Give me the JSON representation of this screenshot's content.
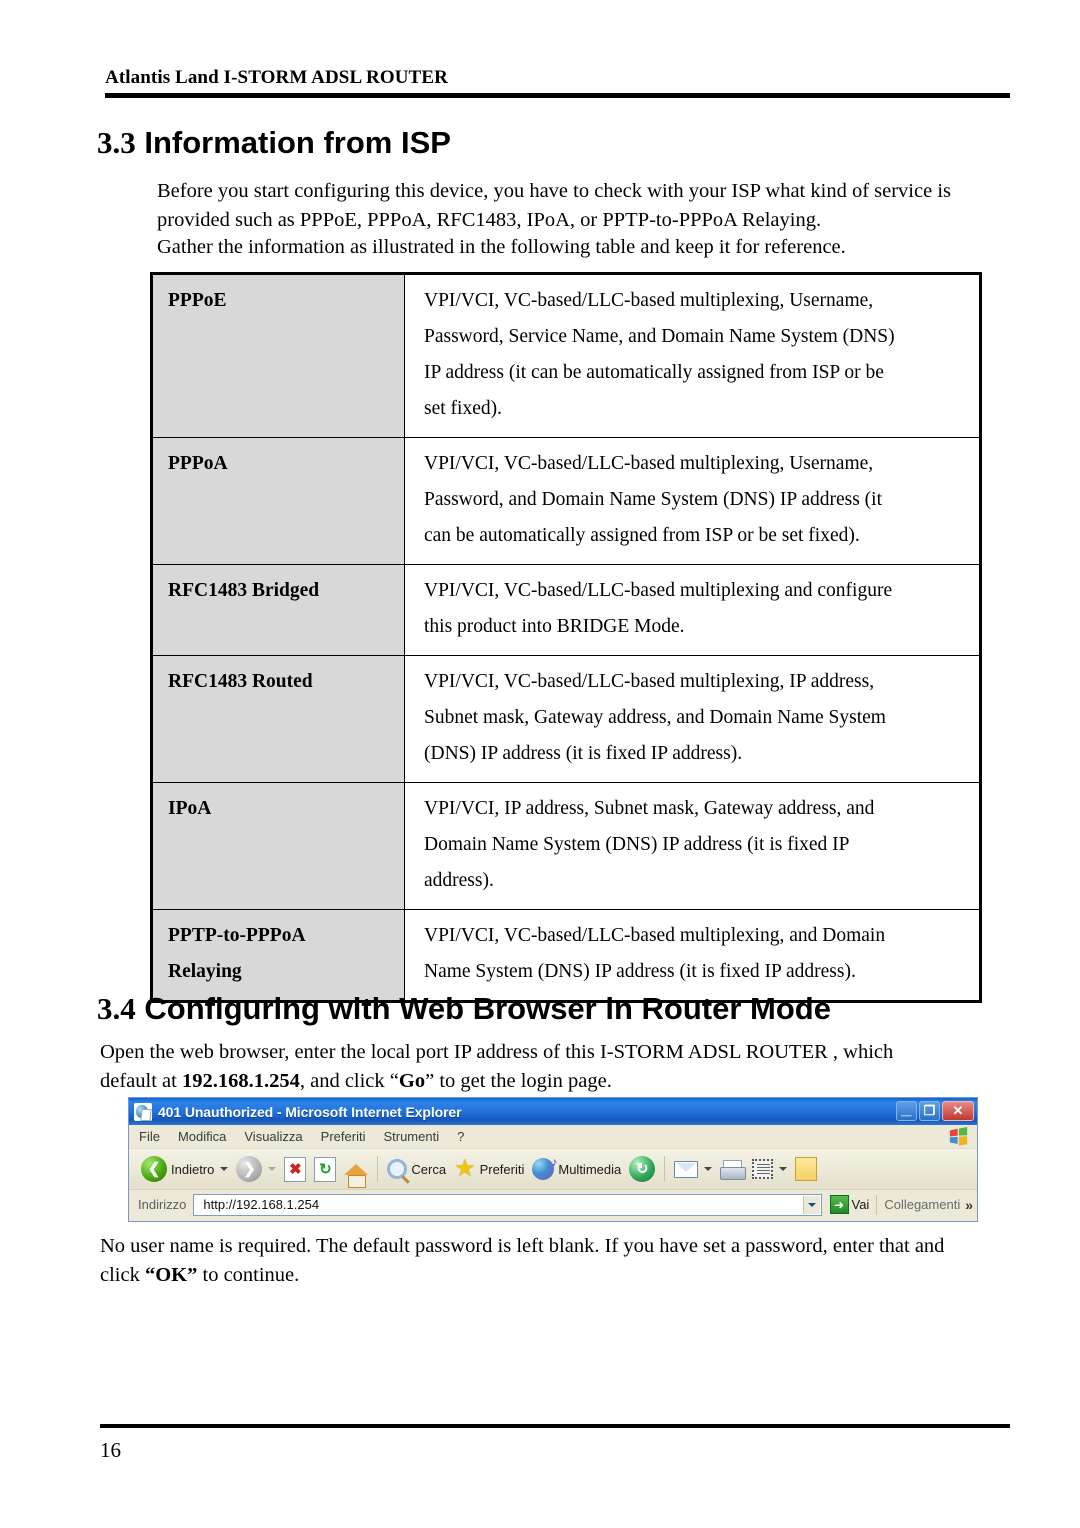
{
  "header": {
    "running_title": "Atlantis Land I-STORM ADSL ROUTER"
  },
  "sections": {
    "s33": {
      "number": "3.3",
      "title": "Information from ISP"
    },
    "s34": {
      "number": "3.4",
      "title": "Configuring with Web Browser in Router Mode"
    }
  },
  "paragraphs": {
    "intro1_line1": "Before you start configuring this device, you have to check with your ISP what kind of service is",
    "intro1_line2": "provided such as PPPoE, PPPoA, RFC1483, IPoA, or PPTP-to-PPPoA Relaying.",
    "intro2": "Gather the information as illustrated in the following table and keep it for reference.",
    "browser_line1_a": "Open the web browser, enter the local port IP address of this I-STORM ADSL ROUTER , which",
    "browser_line2_a": "default at ",
    "browser_line2_b": "192.168.1.254",
    "browser_line2_c": ", and click “",
    "browser_line2_d": "Go",
    "browser_line2_e": "” to get the login page.",
    "login_line1": "No user name is required. The default password is left blank. If you have set a password, enter that and",
    "login_line2_a": "click ",
    "login_line2_b": "“OK”",
    "login_line2_c": " to continue."
  },
  "isp_table": {
    "rows": [
      {
        "key": "PPPoE",
        "lines": [
          "VPI/VCI, VC-based/LLC-based multiplexing, Username,",
          "Password, Service Name, and Domain Name System (DNS)",
          "IP address (it can be automatically assigned from ISP or be",
          "set fixed)."
        ]
      },
      {
        "key": "PPPoA",
        "lines": [
          "VPI/VCI, VC-based/LLC-based multiplexing, Username,",
          "Password, and Domain Name System (DNS) IP address (it",
          "can be automatically assigned from ISP or be set fixed)."
        ]
      },
      {
        "key": "RFC1483 Bridged",
        "lines": [
          "VPI/VCI, VC-based/LLC-based multiplexing and configure",
          "this product into BRIDGE Mode."
        ]
      },
      {
        "key": "RFC1483 Routed",
        "lines": [
          "VPI/VCI, VC-based/LLC-based multiplexing, IP address,",
          "Subnet mask, Gateway address, and Domain Name System",
          "(DNS) IP address (it is fixed IP address)."
        ]
      },
      {
        "key": "IPoA",
        "lines": [
          "VPI/VCI, IP address, Subnet mask, Gateway address, and",
          "Domain Name System (DNS) IP address (it is fixed IP",
          "address)."
        ]
      },
      {
        "key_line1": "PPTP-to-PPPoA",
        "key_line2": "Relaying",
        "key": "PPTP-to-PPPoA Relaying",
        "lines": [
          "VPI/VCI, VC-based/LLC-based multiplexing, and Domain",
          "Name System (DNS) IP address (it is fixed IP address)."
        ]
      }
    ]
  },
  "browser": {
    "window_title": "401 Unauthorized - Microsoft Internet Explorer",
    "window_buttons": {
      "minimize": "_",
      "restore": "❐",
      "close": "✕"
    },
    "menu": [
      "File",
      "Modifica",
      "Visualizza",
      "Preferiti",
      "Strumenti",
      "?"
    ],
    "toolbar": {
      "back": "Indietro",
      "search": "Cerca",
      "favorites": "Preferiti",
      "multimedia": "Multimedia"
    },
    "address": {
      "label": "Indirizzo",
      "url": "http://192.168.1.254",
      "go": "Vai",
      "links": "Collegamenti",
      "chevron": "»"
    },
    "colors": {
      "titlebar_blue": "#1f6fd8",
      "chrome": "#ece9d8",
      "close_red": "#c0392f",
      "go_green": "#1f8a28"
    }
  },
  "footer": {
    "page_number": "16"
  },
  "style": {
    "table_key_bg": "#d8d8d8",
    "text_color": "#000000"
  }
}
